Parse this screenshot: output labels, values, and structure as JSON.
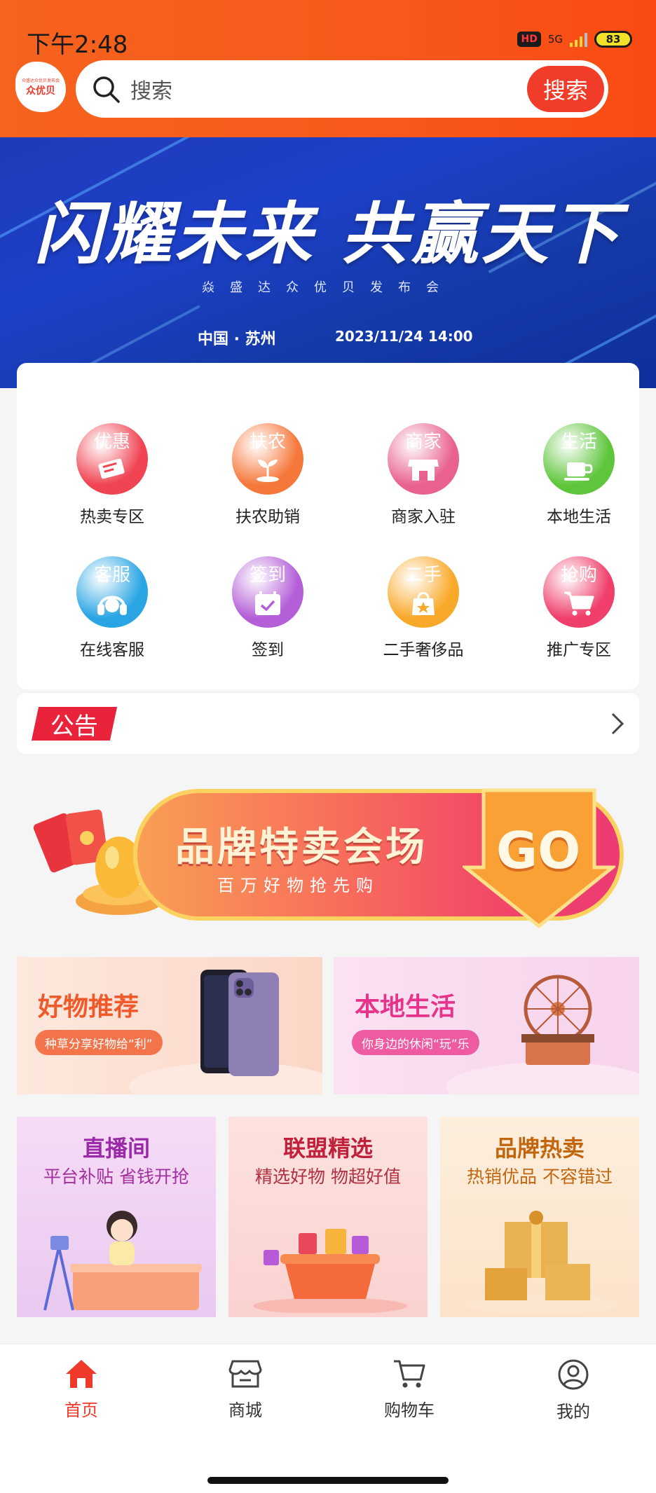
{
  "status_bar": {
    "time": "下午2:48",
    "hd": "HD",
    "network": "5G",
    "battery": "83"
  },
  "header": {
    "logo_text": "众优贝",
    "logo_small": "众盛达众优贝发布会",
    "search_placeholder": "搜索",
    "search_button": "搜索"
  },
  "banner": {
    "title": "闪耀未来 共赢天下",
    "subtitle": "焱盛达众优贝发布会",
    "location": "中国 · 苏州",
    "datetime": "2023/11/24 14:00"
  },
  "categories": [
    {
      "badge": "优惠",
      "label": "热卖专区",
      "icon": "ticket-icon",
      "color": "#f04453"
    },
    {
      "badge": "扶农",
      "label": "扶农助销",
      "icon": "sprout-icon",
      "color": "#f6773a"
    },
    {
      "badge": "商家",
      "label": "商家入驻",
      "icon": "store-icon",
      "color": "#e9628d"
    },
    {
      "badge": "生活",
      "label": "本地生活",
      "icon": "coffee-icon",
      "color": "#5fc63c"
    },
    {
      "badge": "客服",
      "label": "在线客服",
      "icon": "headset-icon",
      "color": "#2aa5e4"
    },
    {
      "badge": "签到",
      "label": "签到",
      "icon": "calendar-icon",
      "color": "#b45ed8"
    },
    {
      "badge": "二手",
      "label": "二手奢侈品",
      "icon": "bag-icon",
      "color": "#f9a92a"
    },
    {
      "badge": "抢购",
      "label": "推广专区",
      "icon": "cart-icon",
      "color": "#ef3f6a"
    }
  ],
  "notice": {
    "tag": "公告"
  },
  "promo": {
    "title": "品牌特卖会场",
    "subtitle": "百万好物抢先购",
    "go": "GO"
  },
  "feature_tiles": [
    {
      "title": "好物推荐",
      "tagline": "种草分享好物给“利”",
      "title_color": "#f05a2a",
      "pill_color": "#f3744a"
    },
    {
      "title": "本地生活",
      "tagline": "你身边的休闲“玩”乐",
      "title_color": "#e8338a",
      "pill_color": "#ef5ba1"
    }
  ],
  "channel_tiles": [
    {
      "title": "直播间",
      "subtitle": "平台补贴 省钱开抢",
      "title_color": "#9b2aa8"
    },
    {
      "title": "联盟精选",
      "subtitle": "精选好物 物超好值",
      "title_color": "#c0203a"
    },
    {
      "title": "品牌热卖",
      "subtitle": "热销优品 不容错过",
      "title_color": "#c2660e"
    }
  ],
  "tabbar": [
    {
      "label": "首页",
      "icon": "home-icon",
      "active": true
    },
    {
      "label": "商城",
      "icon": "shop-icon",
      "active": false
    },
    {
      "label": "购物车",
      "icon": "cart-icon",
      "active": false
    },
    {
      "label": "我的",
      "icon": "user-icon",
      "active": false
    }
  ]
}
